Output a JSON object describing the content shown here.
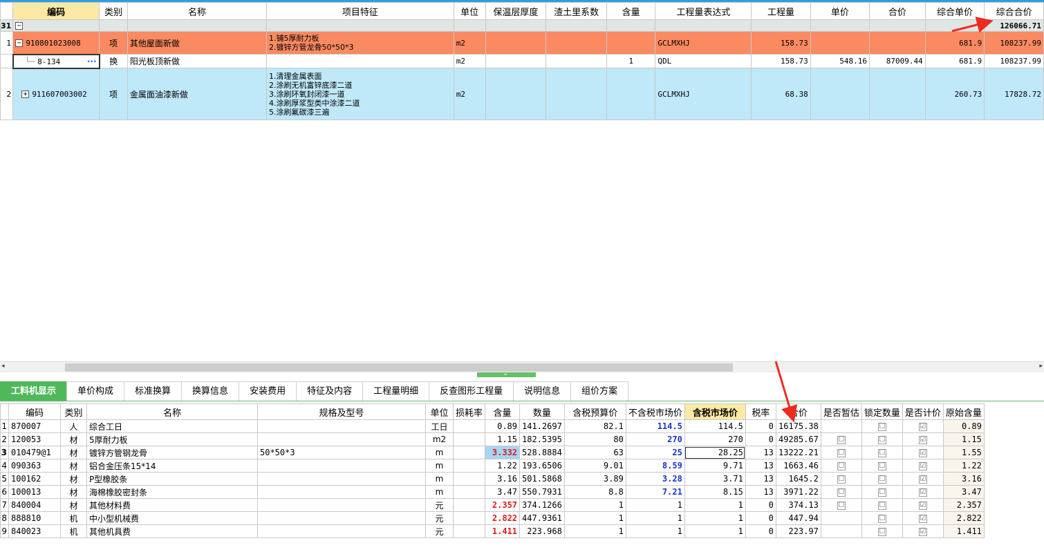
{
  "upper": {
    "headers": [
      "编码",
      "类别",
      "名称",
      "项目特征",
      "单位",
      "保温层厚度",
      "渣土里系数",
      "含量",
      "工程量表达式",
      "工程量",
      "单价",
      "合价",
      "综合单价",
      "综合合价"
    ],
    "sum_row": {
      "rownum": "31",
      "total": "126066.71"
    },
    "rows": [
      {
        "rownum": "1",
        "expand": "−",
        "code": "910801023008",
        "type": "项",
        "name": "其他屋面新做",
        "feature": "1.铺5厚耐力板\n2.镀锌方管龙骨50*50*3",
        "unit": "m2",
        "thick": "",
        "coef": "",
        "content": "",
        "expr": "GCLMXHJ",
        "qty": "158.73",
        "price": "",
        "amount": "",
        "cprice": "681.9",
        "ctotal": "108237.99"
      },
      {
        "rownum": "",
        "expand": "",
        "code": "8-134",
        "ellipsis": "···",
        "type": "换",
        "name": "阳光板顶新做",
        "feature": "",
        "unit": "m2",
        "thick": "",
        "coef": "",
        "content": "1",
        "expr": "QDL",
        "qty": "158.73",
        "price": "548.16",
        "amount": "87009.44",
        "cprice": "681.9",
        "ctotal": "108237.99"
      },
      {
        "rownum": "2",
        "expand": "+",
        "code": "911607003002",
        "type": "项",
        "name": "金属面油漆新做",
        "feature": "1.清理金属表面\n2.涂刷无机富锌底漆二道\n3.涂刷环氧封闭漆一道\n4.涂刷厚浆型类中涂漆二道\n5.涂刷氟碳漆三遍",
        "unit": "m2",
        "thick": "",
        "coef": "",
        "content": "",
        "expr": "GCLMXHJ",
        "qty": "68.38",
        "price": "",
        "amount": "",
        "cprice": "260.73",
        "ctotal": "17828.72"
      }
    ]
  },
  "tabs": [
    "工料机显示",
    "单价构成",
    "标准换算",
    "换算信息",
    "安装费用",
    "特征及内容",
    "工程量明细",
    "反查图形工程量",
    "说明信息",
    "组价方案"
  ],
  "lower": {
    "headers": [
      "编码",
      "类别",
      "名称",
      "规格及型号",
      "单位",
      "损耗率",
      "含量",
      "数量",
      "含税预算价",
      "不含税市场价",
      "含税市场价",
      "税率",
      "合价",
      "是否暂估",
      "锁定数量",
      "是否计价",
      "原始含量"
    ],
    "rows": [
      {
        "n": "1",
        "code": "870007",
        "type": "人",
        "name": "综合工日",
        "spec": "",
        "unit": "工日",
        "loss": "",
        "content": "0.89",
        "qty": "141.2697",
        "budget": "82.1",
        "market": "114.5",
        "taxmarket": "114.5",
        "rate": "0",
        "total": "16175.38",
        "temp": "",
        "lock": "☐",
        "priced": "☑",
        "orig": "0.89",
        "cstyle": "",
        "mstyle": "blue"
      },
      {
        "n": "2",
        "code": "120053",
        "type": "材",
        "name": "5厚耐力板",
        "spec": "",
        "unit": "m2",
        "loss": "",
        "content": "1.15",
        "qty": "182.5395",
        "budget": "80",
        "market": "270",
        "taxmarket": "270",
        "rate": "0",
        "total": "49285.67",
        "temp": "☐",
        "lock": "☐",
        "priced": "☑",
        "orig": "1.15",
        "cstyle": "",
        "mstyle": "blue"
      },
      {
        "n": "3",
        "code": "010479@1",
        "type": "材",
        "name": "镀锌方管钢龙骨",
        "spec": "50*50*3",
        "unit": "m",
        "loss": "",
        "content": "3.332",
        "qty": "528.8884",
        "budget": "63",
        "market": "25",
        "taxmarket": "28.25",
        "rate": "13",
        "total": "13222.21",
        "temp": "☐",
        "lock": "☐",
        "priced": "☑",
        "orig": "1.55",
        "cstyle": "redsel",
        "mstyle": "blue"
      },
      {
        "n": "4",
        "code": "090363",
        "type": "材",
        "name": "铝合金压条15*14",
        "spec": "",
        "unit": "m",
        "loss": "",
        "content": "1.22",
        "qty": "193.6506",
        "budget": "9.01",
        "market": "8.59",
        "taxmarket": "9.71",
        "rate": "13",
        "total": "1663.46",
        "temp": "☐",
        "lock": "☐",
        "priced": "☑",
        "orig": "1.22",
        "cstyle": "",
        "mstyle": "blue"
      },
      {
        "n": "5",
        "code": "100162",
        "type": "材",
        "name": "P型橡胶条",
        "spec": "",
        "unit": "m",
        "loss": "",
        "content": "3.16",
        "qty": "501.5868",
        "budget": "3.89",
        "market": "3.28",
        "taxmarket": "3.71",
        "rate": "13",
        "total": "1645.2",
        "temp": "☐",
        "lock": "☐",
        "priced": "☑",
        "orig": "3.16",
        "cstyle": "",
        "mstyle": "blue"
      },
      {
        "n": "6",
        "code": "100013",
        "type": "材",
        "name": "海棉橡胶密封条",
        "spec": "",
        "unit": "m",
        "loss": "",
        "content": "3.47",
        "qty": "550.7931",
        "budget": "8.8",
        "market": "7.21",
        "taxmarket": "8.15",
        "rate": "13",
        "total": "3971.22",
        "temp": "☐",
        "lock": "☐",
        "priced": "☑",
        "orig": "3.47",
        "cstyle": "",
        "mstyle": "blue"
      },
      {
        "n": "7",
        "code": "840004",
        "type": "材",
        "name": "其他材料费",
        "spec": "",
        "unit": "元",
        "loss": "",
        "content": "2.357",
        "qty": "374.1266",
        "budget": "1",
        "market": "1",
        "taxmarket": "1",
        "rate": "0",
        "total": "374.13",
        "temp": "☐",
        "lock": "☐",
        "priced": "☑",
        "orig": "2.357",
        "cstyle": "red",
        "mstyle": ""
      },
      {
        "n": "8",
        "code": "888810",
        "type": "机",
        "name": "中小型机械费",
        "spec": "",
        "unit": "元",
        "loss": "",
        "content": "2.822",
        "qty": "447.9361",
        "budget": "1",
        "market": "1",
        "taxmarket": "1",
        "rate": "0",
        "total": "447.94",
        "temp": "",
        "lock": "☐",
        "priced": "☑",
        "orig": "2.822",
        "cstyle": "red",
        "mstyle": ""
      },
      {
        "n": "9",
        "code": "840023",
        "type": "机",
        "name": "其他机具费",
        "spec": "",
        "unit": "元",
        "loss": "",
        "content": "1.411",
        "qty": "223.968",
        "budget": "1",
        "market": "1",
        "taxmarket": "1",
        "rate": "0",
        "total": "223.97",
        "temp": "",
        "lock": "☐",
        "priced": "☑",
        "orig": "1.411",
        "cstyle": "red",
        "mstyle": ""
      }
    ]
  }
}
